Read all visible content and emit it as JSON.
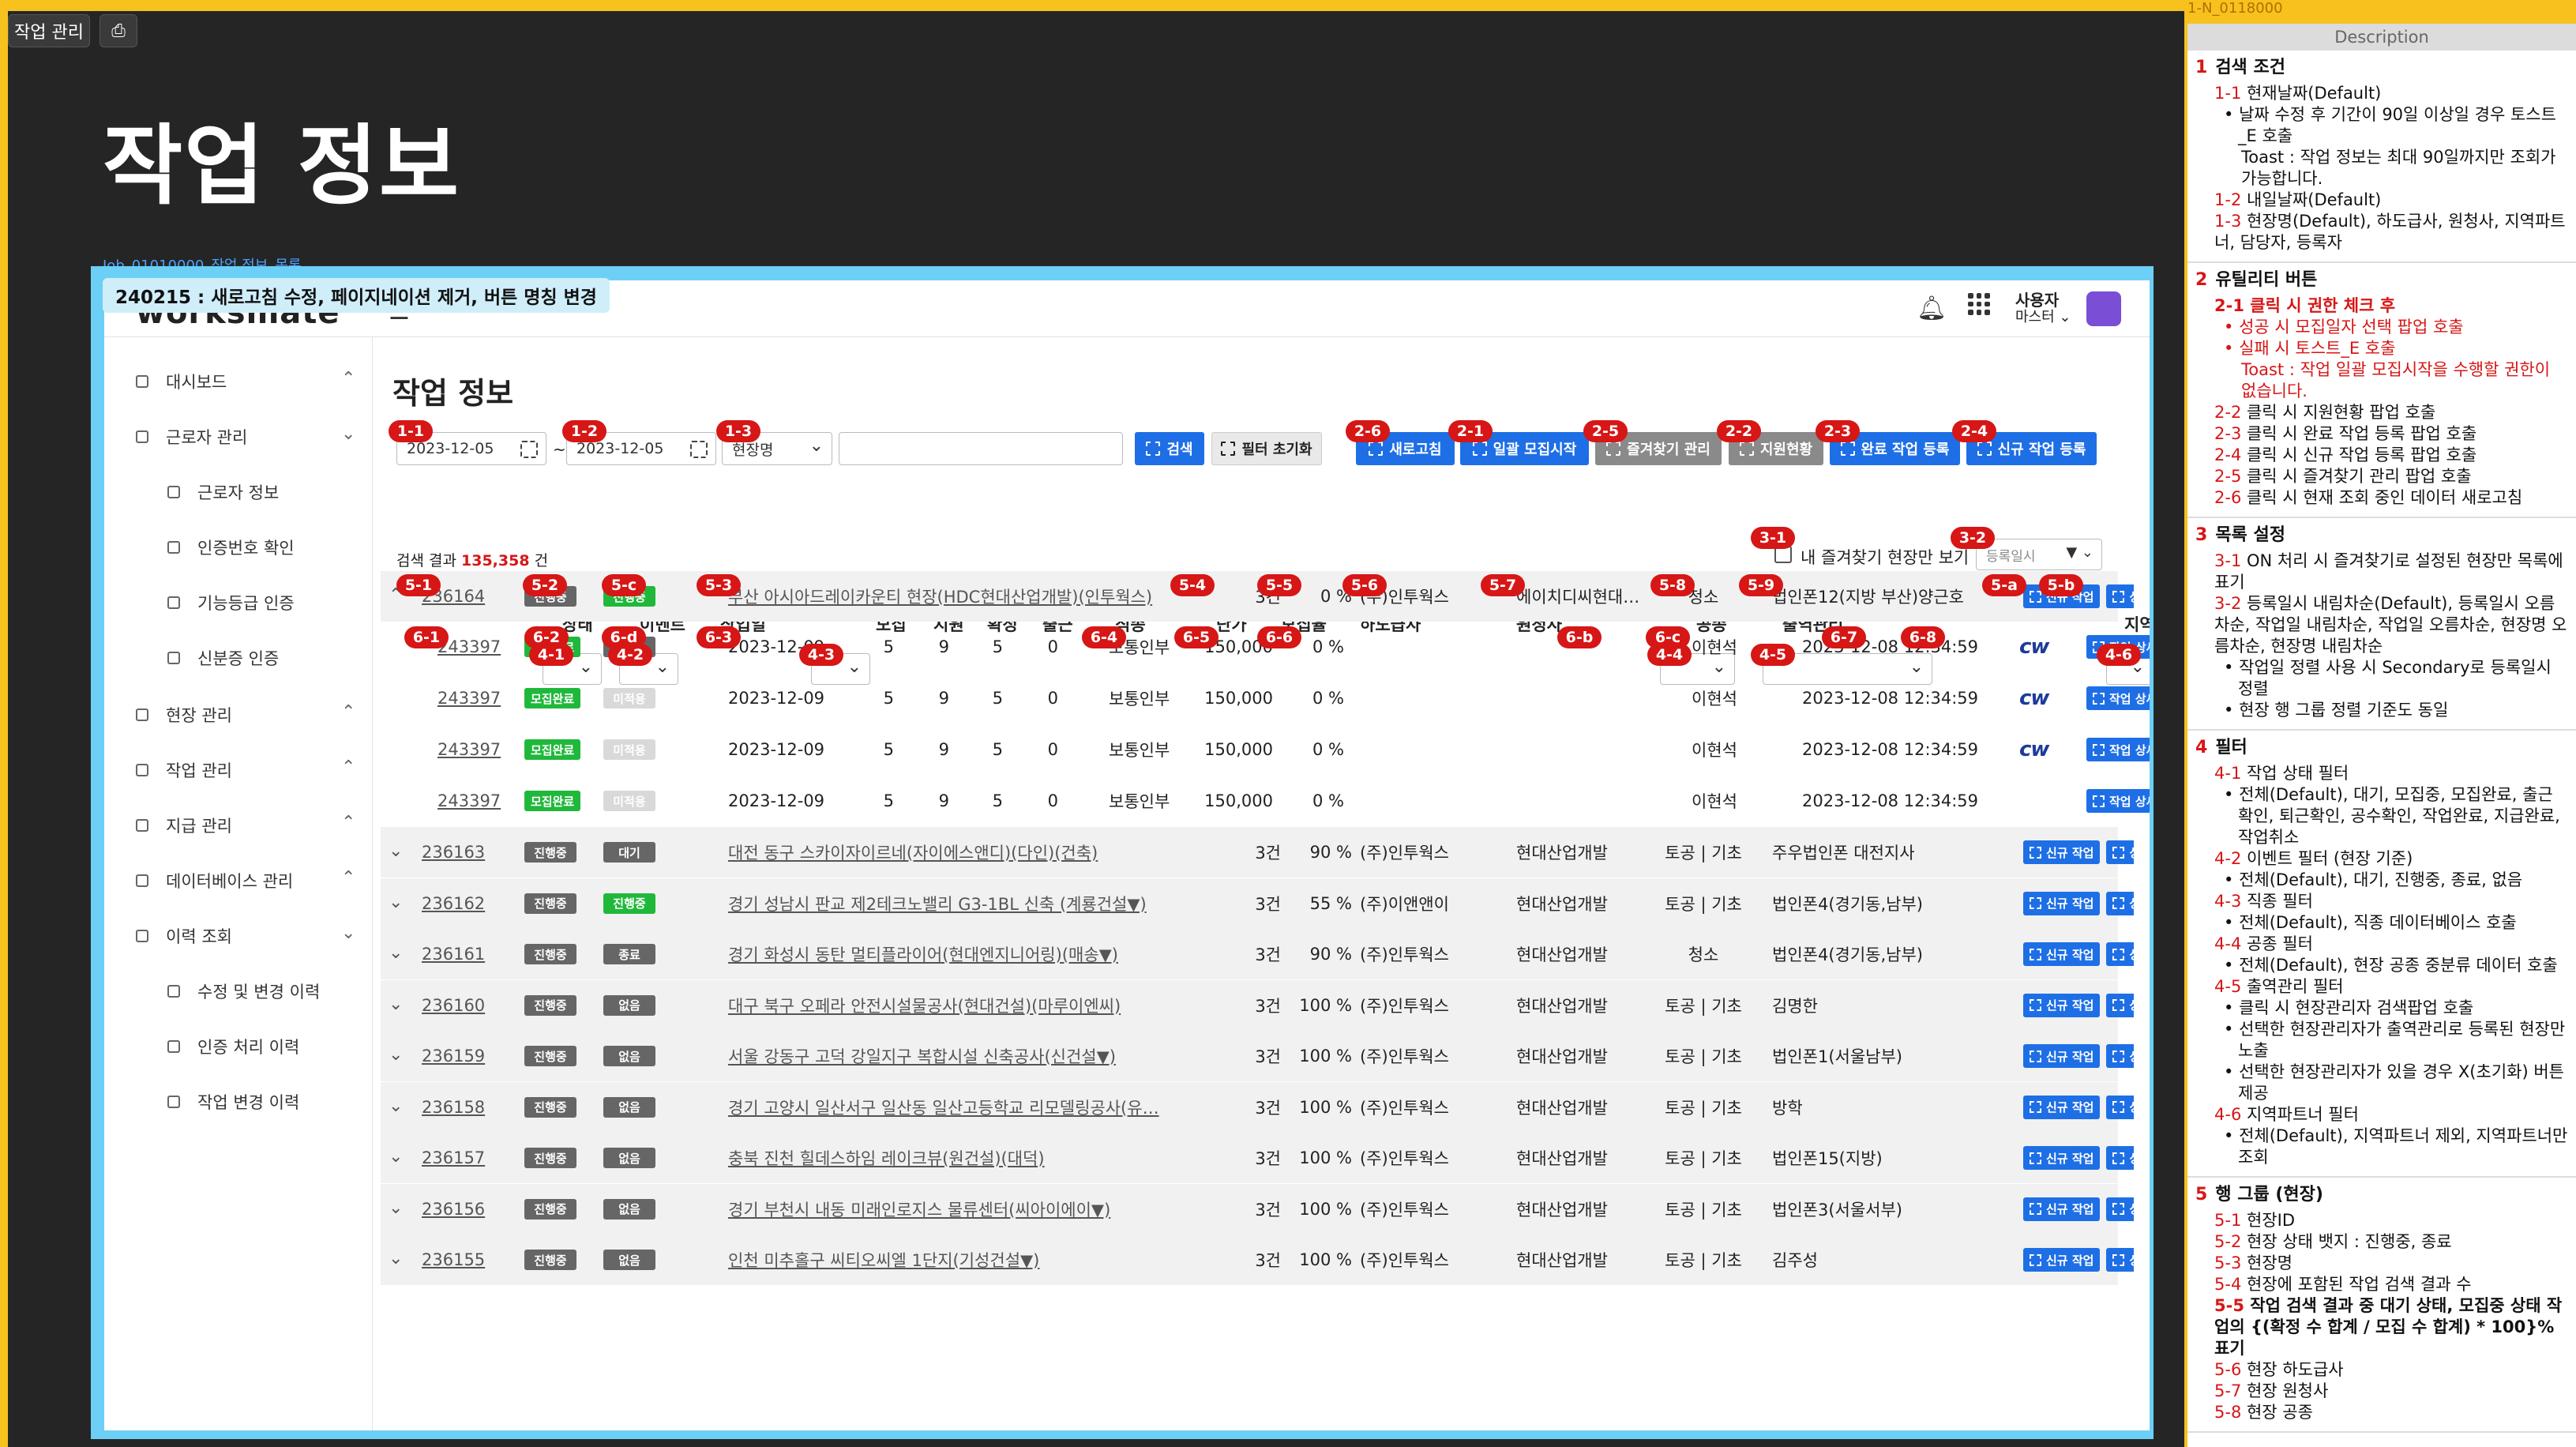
{
  "top_label": "1-N_0118000",
  "chips": {
    "title": "작업 관리"
  },
  "big_title": "작업 정보",
  "frame_id": "Job_01010000_작업 정보_목록",
  "change_note": "240215 : 새로고침 수정, 페이지네이션 제거, 버튼 명칭 변경",
  "topbar": {
    "logo": "worksmate",
    "user_name": "사용자",
    "user_role": "마스터 ⌄"
  },
  "sidebar": [
    {
      "label": "대시보드",
      "level": 0,
      "chev": "⌃"
    },
    {
      "label": "근로자 관리",
      "level": 0,
      "chev": "⌄"
    },
    {
      "label": "근로자 정보",
      "level": 1
    },
    {
      "label": "인증번호 확인",
      "level": 1
    },
    {
      "label": "기능등급 인증",
      "level": 1
    },
    {
      "label": "신분증 인증",
      "level": 1
    },
    {
      "label": "현장 관리",
      "level": 0,
      "chev": "⌃"
    },
    {
      "label": "작업 관리",
      "level": 0,
      "chev": "⌃"
    },
    {
      "label": "지급 관리",
      "level": 0,
      "chev": "⌃"
    },
    {
      "label": "데이터베이스 관리",
      "level": 0,
      "chev": "⌃"
    },
    {
      "label": "이력 조회",
      "level": 0,
      "chev": "⌄"
    },
    {
      "label": "수정 및 변경 이력",
      "level": 1
    },
    {
      "label": "인증 처리 이력",
      "level": 1
    },
    {
      "label": "작업 변경 이력",
      "level": 1
    }
  ],
  "page_title": "작업 정보",
  "search": {
    "date_from": "2023-12-05",
    "tilde": "~",
    "date_to": "2023-12-05",
    "type_select": "현장명",
    "keyword": "",
    "search_btn": "검색",
    "reset_btn": "필터 초기화"
  },
  "utility_buttons": [
    "새로고침",
    "일괄 모집시작",
    "즐겨찾기 관리",
    "지원현황",
    "완료 작업 등록",
    "신규 작업 등록"
  ],
  "result": {
    "prefix": "검색 결과 ",
    "count": "135,358",
    "suffix": " 건"
  },
  "favorite_label": "내 즐겨찾기 현장만 보기",
  "sort_select": "등록일시",
  "columns": [
    "상태",
    "이벤트",
    "작업일",
    "모집",
    "지원",
    "확정",
    "출근",
    "직종",
    "단가",
    "모집율",
    "하도급사",
    "원청사",
    "공종",
    "출역관리",
    "지역"
  ],
  "badges": {
    "b11": "1-1",
    "b12": "1-2",
    "b13": "1-3",
    "b26": "2-6",
    "b21": "2-1",
    "b25": "2-5",
    "b22": "2-2",
    "b23": "2-3",
    "b24": "2-4",
    "b31": "3-1",
    "b32": "3-2",
    "b41": "4-1",
    "b42": "4-2",
    "b43": "4-3",
    "b44": "4-4",
    "b45": "4-5",
    "b46": "4-6",
    "b51": "5-1",
    "b52": "5-2",
    "b5c": "5-c",
    "b53": "5-3",
    "b54": "5-4",
    "b55": "5-5",
    "b56": "5-6",
    "b57": "5-7",
    "b58": "5-8",
    "b59": "5-9",
    "b5a": "5-a",
    "b5b": "5-b",
    "b61": "6-1",
    "b62": "6-2",
    "b6d": "6-d",
    "b63": "6-3",
    "b64": "6-4",
    "b65": "6-5",
    "b66": "6-6",
    "b6b": "6-b",
    "b6c": "6-c",
    "b67": "6-7",
    "b68": "6-8"
  },
  "group_first": {
    "id": "236164",
    "state": "진행중",
    "event": "진행중",
    "name": "부산 아시아드레이카운티 현장(HDC현대산업개발)(인투웍스)",
    "crew": "3건",
    "rate": "0 %",
    "sub": "(주)인투웍스",
    "prime": "에이치디씨현대…",
    "trade": "청소",
    "manager": "법인폰12(지방 부산)양근호",
    "btn_new": "신규 작업",
    "btn_detail": "상세"
  },
  "jobs": [
    {
      "id": "243397",
      "state": "모집완료",
      "event": "적용",
      "date": "2023-12-09",
      "recruit": "5",
      "apply": "9",
      "confirm": "5",
      "attend": "0",
      "job": "보통인부",
      "price": "150,000",
      "rate": "0 %",
      "person": "이현석",
      "dt": "2023-12-08 12:34:59",
      "logo": "cw",
      "btn": "작업 상세"
    },
    {
      "id": "243397",
      "state": "모집완료",
      "event": "미적용",
      "date": "2023-12-09",
      "recruit": "5",
      "apply": "9",
      "confirm": "5",
      "attend": "0",
      "job": "보통인부",
      "price": "150,000",
      "rate": "0 %",
      "person": "이현석",
      "dt": "2023-12-08 12:34:59",
      "logo": "cw",
      "btn": "작업 상세"
    },
    {
      "id": "243397",
      "state": "모집완료",
      "event": "미적용",
      "date": "2023-12-09",
      "recruit": "5",
      "apply": "9",
      "confirm": "5",
      "attend": "0",
      "job": "보통인부",
      "price": "150,000",
      "rate": "0 %",
      "person": "이현석",
      "dt": "2023-12-08 12:34:59",
      "logo": "cw",
      "btn": "작업 상세"
    },
    {
      "id": "243397",
      "state": "모집완료",
      "event": "미적용",
      "date": "2023-12-09",
      "recruit": "5",
      "apply": "9",
      "confirm": "5",
      "attend": "0",
      "job": "보통인부",
      "price": "150,000",
      "rate": "0 %",
      "person": "이현석",
      "dt": "2023-12-08 12:34:59",
      "logo": "",
      "btn": "작업 상세"
    }
  ],
  "groups": [
    {
      "id": "236163",
      "state": "진행중",
      "event": "대기",
      "evcolor": "dark",
      "name": "대전 동구 스카이자이르네(자이에스앤디)(다인)(건축)",
      "crew": "3건",
      "rate": "90 %",
      "sub": "(주)인투웍스",
      "prime": "현대산업개발",
      "trade": "토공 | 기초",
      "manager": "주우법인폰 대전지사"
    },
    {
      "id": "236162",
      "state": "진행중",
      "event": "진행중",
      "evcolor": "green",
      "name": "경기 성남시 판교 제2테크노밸리 G3-1BL 신축 (계룡건설▼)",
      "crew": "3건",
      "rate": "55 %",
      "sub": "(주)이앤앤이",
      "prime": "현대산업개발",
      "trade": "토공 | 기초",
      "manager": "법인폰4(경기동,남부)"
    },
    {
      "id": "236161",
      "state": "진행중",
      "event": "종료",
      "evcolor": "dark",
      "name": "경기 화성시 동탄 멀티플라이어(현대엔지니어링)(매송▼)",
      "crew": "3건",
      "rate": "90 %",
      "sub": "(주)인투웍스",
      "prime": "현대산업개발",
      "trade": "청소",
      "manager": "법인폰4(경기동,남부)"
    },
    {
      "id": "236160",
      "state": "진행중",
      "event": "없음",
      "evcolor": "dark",
      "name": "대구 북구 오페라 안전시설물공사(현대건설)(마루이엔씨)",
      "crew": "3건",
      "rate": "100 %",
      "sub": "(주)인투웍스",
      "prime": "현대산업개발",
      "trade": "토공 | 기초",
      "manager": "김명한"
    },
    {
      "id": "236159",
      "state": "진행중",
      "event": "없음",
      "evcolor": "dark",
      "name": "서울 강동구 고덕 강일지구 복합시설 신축공사(신건설▼)",
      "crew": "3건",
      "rate": "100 %",
      "sub": "(주)인투웍스",
      "prime": "현대산업개발",
      "trade": "토공 | 기초",
      "manager": "법인폰1(서울남부)"
    },
    {
      "id": "236158",
      "state": "진행중",
      "event": "없음",
      "evcolor": "dark",
      "name": "경기 고양시 일산서구 일산동 일산고등학교 리모델링공사(유…",
      "crew": "3건",
      "rate": "100 %",
      "sub": "(주)인투웍스",
      "prime": "현대산업개발",
      "trade": "토공 | 기초",
      "manager": "방학"
    },
    {
      "id": "236157",
      "state": "진행중",
      "event": "없음",
      "evcolor": "dark",
      "name": "충북 진천 힐데스하임 레이크뷰(원건설)(대덕)",
      "crew": "3건",
      "rate": "100 %",
      "sub": "(주)인투웍스",
      "prime": "현대산업개발",
      "trade": "토공 | 기초",
      "manager": "법인폰15(지방)"
    },
    {
      "id": "236156",
      "state": "진행중",
      "event": "없음",
      "evcolor": "dark",
      "name": "경기 부천시 내동 미래인로지스 물류센터(씨아이에이▼)",
      "crew": "3건",
      "rate": "100 %",
      "sub": "(주)인투웍스",
      "prime": "현대산업개발",
      "trade": "토공 | 기초",
      "manager": "법인폰3(서울서부)"
    },
    {
      "id": "236155",
      "state": "진행중",
      "event": "없음",
      "evcolor": "dark",
      "name": "인천 미추홀구 씨티오씨엘 1단지(기성건설▼)",
      "crew": "3건",
      "rate": "100 %",
      "sub": "(주)인투웍스",
      "prime": "현대산업개발",
      "trade": "토공 | 기초",
      "manager": "김주성"
    }
  ],
  "group_btn_new": "신규 작업",
  "group_btn_detail": "상세",
  "description": {
    "header": "Description",
    "sections": [
      {
        "num": "1",
        "title": "검색 조건",
        "lines": [
          {
            "t": "1-1 현재날짜(Default)",
            "k": "n"
          },
          {
            "t": "날짜 수정 후 기간이 90일 이상일 경우 토스트_E 호출",
            "k": "b"
          },
          {
            "t": "Toast : 작업 정보는 최대 90일까지만 조회가 가능합니다.",
            "k": "c"
          },
          {
            "t": "1-2 내일날짜(Default)",
            "k": "n"
          },
          {
            "t": "1-3 현장명(Default), 하도급사, 원청사, 지역파트너, 담당자, 등록자",
            "k": "n"
          }
        ]
      },
      {
        "num": "2",
        "title": "유틸리티 버튼",
        "lines": [
          {
            "t": "2-1 클릭 시 권한 체크 후",
            "k": "nr"
          },
          {
            "t": "성공 시 모집일자 선택 팝업 호출",
            "k": "br"
          },
          {
            "t": "실패 시 토스트_E 호출",
            "k": "br"
          },
          {
            "t": "Toast : 작업 일괄 모집시작을 수행할 권한이 없습니다.",
            "k": "cr"
          },
          {
            "t": "2-2 클릭 시 지원현황 팝업 호출",
            "k": "n"
          },
          {
            "t": "2-3 클릭 시 완료 작업 등록 팝업 호출",
            "k": "n"
          },
          {
            "t": "2-4 클릭 시 신규 작업 등록 팝업 호출",
            "k": "n"
          },
          {
            "t": "2-5 클릭 시 즐겨찾기 관리 팝업 호출",
            "k": "n"
          },
          {
            "t": "2-6 클릭 시 현재 조회 중인 데이터 새로고침",
            "k": "n"
          }
        ]
      },
      {
        "num": "3",
        "title": "목록 설정",
        "lines": [
          {
            "t": "3-1 ON 처리 시 즐겨찾기로 설정된 현장만 목록에 표기",
            "k": "n"
          },
          {
            "t": "3-2 등록일시 내림차순(Default), 등록일시 오름차순, 작업일 내림차순, 작업일 오름차순, 현장명 오름차순, 현장명 내림차순",
            "k": "n"
          },
          {
            "t": "작업일 정렬 사용 시 Secondary로 등록일시 정렬",
            "k": "b"
          },
          {
            "t": "현장 행 그룹 정렬 기준도 동일",
            "k": "b"
          }
        ]
      },
      {
        "num": "4",
        "title": "필터",
        "lines": [
          {
            "t": "4-1 작업 상태 필터",
            "k": "n"
          },
          {
            "t": "전체(Default), 대기, 모집중, 모집완료, 출근확인, 퇴근확인, 공수확인, 작업완료, 지급완료, 작업취소",
            "k": "b"
          },
          {
            "t": "4-2 이벤트 필터 (현장 기준)",
            "k": "n"
          },
          {
            "t": "전체(Default), 대기, 진행중, 종료, 없음",
            "k": "b"
          },
          {
            "t": "4-3 직종 필터",
            "k": "n"
          },
          {
            "t": "전체(Default), 직종 데이터베이스 호출",
            "k": "b"
          },
          {
            "t": "4-4 공종 필터",
            "k": "n"
          },
          {
            "t": "전체(Default), 현장 공종 중분류 데이터 호출",
            "k": "b"
          },
          {
            "t": "4-5 출역관리 필터",
            "k": "n"
          },
          {
            "t": "클릭 시 현장관리자 검색팝업 호출",
            "k": "b"
          },
          {
            "t": "선택한 현장관리자가 출역관리로 등록된 현장만 노출",
            "k": "b"
          },
          {
            "t": "선택한 현장관리자가 있을 경우 X(초기화) 버튼 제공",
            "k": "b"
          },
          {
            "t": "4-6 지역파트너 필터",
            "k": "n"
          },
          {
            "t": "전체(Default), 지역파트너 제외, 지역파트너만 조회",
            "k": "b"
          }
        ]
      },
      {
        "num": "5",
        "title": "행 그룹 (현장)",
        "lines": [
          {
            "t": "5-1 현장ID",
            "k": "n"
          },
          {
            "t": "5-2 현장 상태 뱃지 : 진행중, 종료",
            "k": "n"
          },
          {
            "t": "5-3 현장명",
            "k": "n"
          },
          {
            "t": "5-4 현장에 포함된 작업 검색 결과 수",
            "k": "n"
          },
          {
            "t": "5-5 작업 검색 결과 중 대기 상태, 모집중 상태 작업의 {(확정 수 합계 / 모집 수 합계) * 100}% 표기",
            "k": "nb"
          },
          {
            "t": "5-6 현장 하도급사",
            "k": "n"
          },
          {
            "t": "5-7 현장 원청사",
            "k": "n"
          },
          {
            "t": "5-8 현장 공종",
            "k": "n"
          }
        ]
      }
    ]
  }
}
